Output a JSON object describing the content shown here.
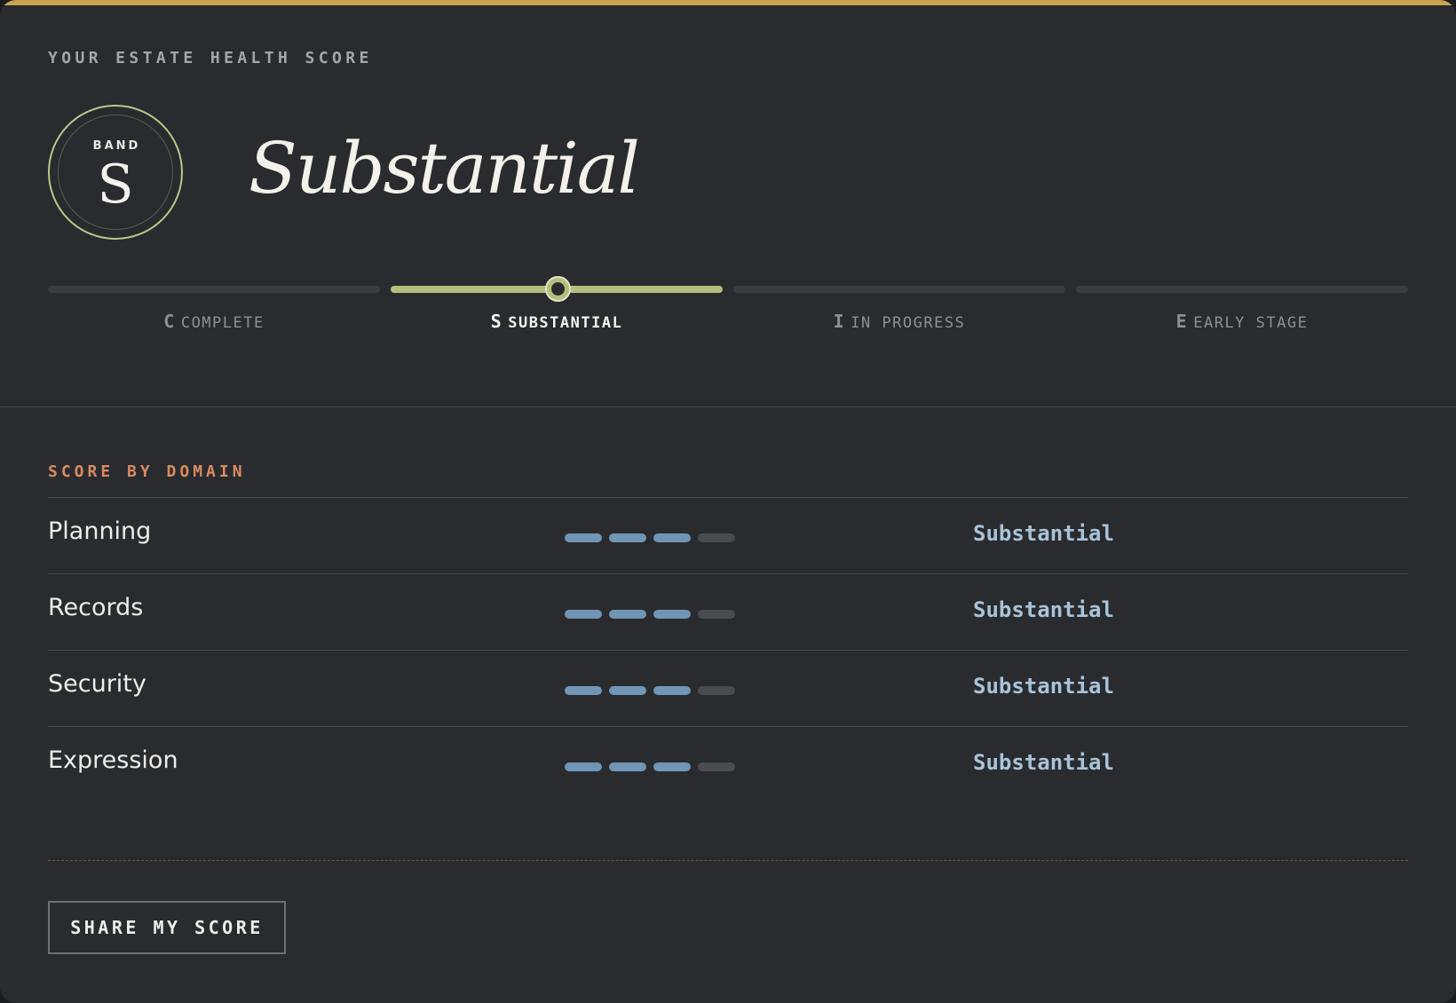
{
  "header": {
    "eyebrow": "YOUR ESTATE HEALTH SCORE",
    "badge_label": "BAND",
    "badge_letter": "S",
    "band_title": "Substantial"
  },
  "scale": {
    "current_index": 1,
    "steps": [
      {
        "code": "C",
        "label": "COMPLETE"
      },
      {
        "code": "S",
        "label": "SUBSTANTIAL"
      },
      {
        "code": "I",
        "label": "IN PROGRESS"
      },
      {
        "code": "E",
        "label": "EARLY STAGE"
      }
    ]
  },
  "domains": {
    "title": "SCORE BY DOMAIN",
    "pill_total": 4,
    "rows": [
      {
        "name": "Planning",
        "filled": 3,
        "score": "Substantial"
      },
      {
        "name": "Records",
        "filled": 3,
        "score": "Substantial"
      },
      {
        "name": "Security",
        "filled": 3,
        "score": "Substantial"
      },
      {
        "name": "Expression",
        "filled": 3,
        "score": "Substantial"
      }
    ]
  },
  "actions": {
    "share_label": "SHARE MY SCORE"
  },
  "colors": {
    "accent_gold": "#c9a654",
    "band_green": "#b5be7e",
    "pill_blue": "#7095b5",
    "section_orange": "#d98c62"
  }
}
